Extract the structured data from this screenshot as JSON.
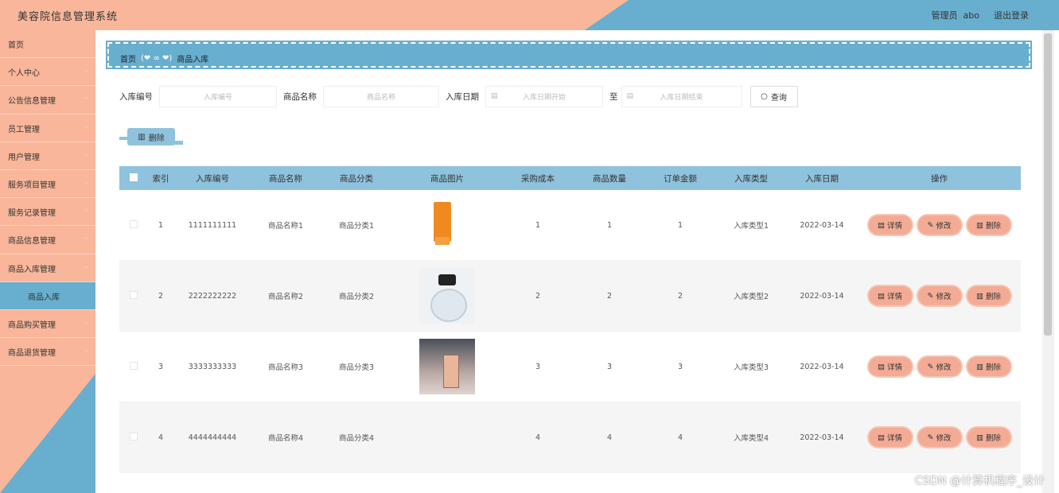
{
  "app": {
    "title": "美容院信息管理系统"
  },
  "header": {
    "role": "管理员",
    "user": "abo",
    "logout": "退出登录"
  },
  "sidebar": {
    "items": [
      {
        "label": "首页",
        "has_children": false
      },
      {
        "label": "个人中心",
        "has_children": true
      },
      {
        "label": "公告信息管理",
        "has_children": true
      },
      {
        "label": "员工管理",
        "has_children": true
      },
      {
        "label": "用户管理",
        "has_children": true
      },
      {
        "label": "服务项目管理",
        "has_children": true
      },
      {
        "label": "服务记录管理",
        "has_children": true
      },
      {
        "label": "商品信息管理",
        "has_children": true
      },
      {
        "label": "商品入库管理",
        "has_children": true
      },
      {
        "label": "商品入库",
        "sub": true
      },
      {
        "label": "商品购买管理",
        "has_children": true
      },
      {
        "label": "商品退货管理",
        "has_children": true
      }
    ]
  },
  "breadcrumb": {
    "home": "首页",
    "current": "商品入库"
  },
  "search": {
    "code_label": "入库编号",
    "code_placeholder": "入库编号",
    "name_label": "商品名称",
    "name_placeholder": "商品名称",
    "date_label": "入库日期",
    "date_start_placeholder": "入库日期开始",
    "to_label": "至",
    "date_end_placeholder": "入库日期结束",
    "query_button": "查询"
  },
  "actions": {
    "delete_button": "删除"
  },
  "table": {
    "headers": [
      "索引",
      "入库编号",
      "商品名称",
      "商品分类",
      "商品图片",
      "采购成本",
      "商品数量",
      "订单金额",
      "入库类型",
      "入库日期",
      "操作"
    ],
    "row_actions": {
      "detail": "详情",
      "edit": "修改",
      "delete": "删除"
    },
    "rows": [
      {
        "index": "1",
        "code": "1111111111",
        "name": "商品名称1",
        "category": "商品分类1",
        "image": "orange-tube",
        "cost": "1",
        "qty": "1",
        "amount": "1",
        "type": "入库类型1",
        "date": "2022-03-14"
      },
      {
        "index": "2",
        "code": "2222222222",
        "name": "商品名称2",
        "category": "商品分类2",
        "image": "perfume-bottle",
        "cost": "2",
        "qty": "2",
        "amount": "2",
        "type": "入库类型2",
        "date": "2022-03-14"
      },
      {
        "index": "3",
        "code": "3333333333",
        "name": "商品名称3",
        "category": "商品分类3",
        "image": "perfume-display",
        "cost": "3",
        "qty": "3",
        "amount": "3",
        "type": "入库类型3",
        "date": "2022-03-14"
      },
      {
        "index": "4",
        "code": "4444444444",
        "name": "商品名称4",
        "category": "商品分类4",
        "image": "",
        "cost": "4",
        "qty": "4",
        "amount": "4",
        "type": "入库类型4",
        "date": "2022-03-14"
      }
    ]
  },
  "watermark": "CSDN @计算机程序_设计",
  "colors": {
    "peach": "#f9b69a",
    "blue": "#68aecf",
    "action": "#f3ab95"
  }
}
